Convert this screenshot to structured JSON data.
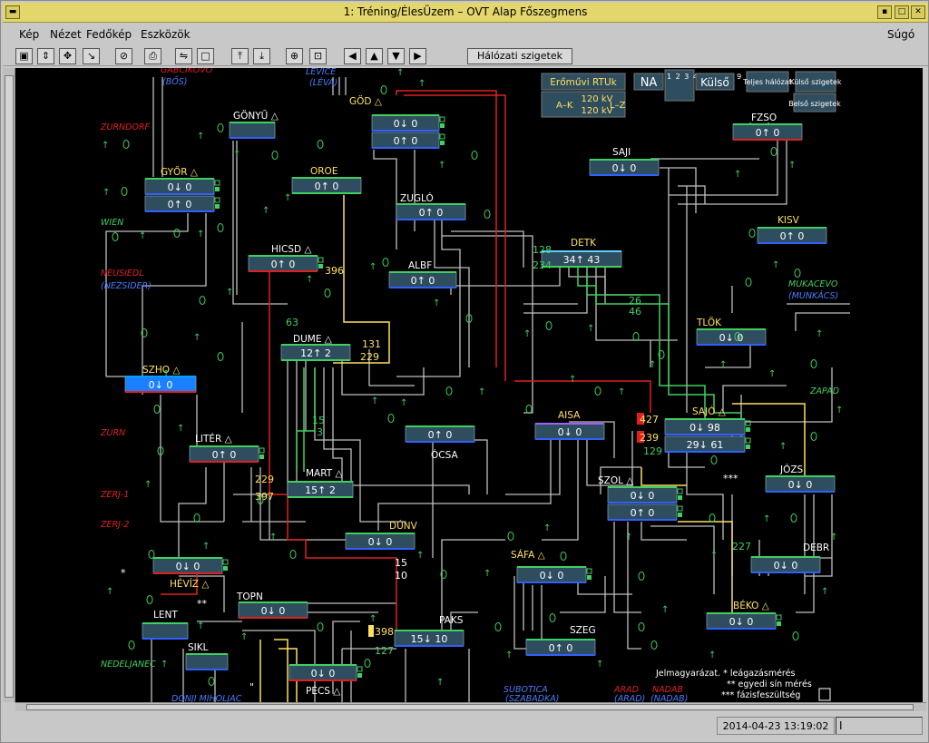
{
  "window": {
    "title": "1: Tréning/ÉlesÜzem – OVT     Alap    Főszegmens"
  },
  "menu": {
    "kep": "Kép",
    "nezet": "Nézet",
    "fedokep": "Fedőkép",
    "eszkozok": "Eszközök",
    "sugo": "Súgó"
  },
  "toolbar": {
    "network_islands": "Hálózati szigetek"
  },
  "panel": {
    "rtu": "Erőművi RTUk",
    "kv1": "120 kV",
    "kv2": "120 kV",
    "ak": "A–K",
    "lz": "L–Z",
    "na": "NA",
    "nums": "1 2 3 4 5 6 7 8 9",
    "kulso": "Külső",
    "teljes": "Teljes hálózat",
    "kulso_sz": "Külső szigetek",
    "belso_sz": "Belső szigetek"
  },
  "legend": {
    "title": "Jelmagyarázat. *  leágazásmérés",
    "l2": "** egyedi sín mérés",
    "l3": "*** fázisfeszültség"
  },
  "status": {
    "datetime": "2014-04-23 13:19:02",
    "cursor": "I"
  },
  "ext_labels": [
    {
      "id": "gabcikovo",
      "t": "GABCIKOVO",
      "c": "#e02020"
    },
    {
      "id": "bos",
      "t": "(BŐS)",
      "c": "#4a7cff"
    },
    {
      "id": "levice",
      "t": "LEVICE",
      "c": "#4a7cff"
    },
    {
      "id": "leva",
      "t": "(LÉVA)",
      "c": "#4a7cff"
    },
    {
      "id": "zurndorf",
      "t": "ZURNDORF",
      "c": "#e02020"
    },
    {
      "id": "wien",
      "t": "WIEN",
      "c": "#40d060"
    },
    {
      "id": "neusiedl",
      "t": "NEUSIEDL",
      "c": "#e02020"
    },
    {
      "id": "nezsider",
      "t": "(NEZSIDER)",
      "c": "#4a7cff"
    },
    {
      "id": "zurn",
      "t": "ZURN",
      "c": "#e02020"
    },
    {
      "id": "zerj1",
      "t": "ZERJ-1",
      "c": "#e02020"
    },
    {
      "id": "zerj2",
      "t": "ZERJ-2",
      "c": "#e02020"
    },
    {
      "id": "nedeljanec",
      "t": "NEDELJANEC",
      "c": "#40d060"
    },
    {
      "id": "donji",
      "t": "DONJI MIHOLJAC",
      "c": "#4a7cff"
    },
    {
      "id": "subotica",
      "t": "SUBOTICA",
      "c": "#4a7cff"
    },
    {
      "id": "szabadka",
      "t": "(SZABADKA)",
      "c": "#4a7cff"
    },
    {
      "id": "arad",
      "t": "ARAD",
      "c": "#e02020"
    },
    {
      "id": "aradp",
      "t": "(ARAD)",
      "c": "#4a7cff"
    },
    {
      "id": "nadab",
      "t": "NADAB",
      "c": "#e02020"
    },
    {
      "id": "nadabp",
      "t": "(NADAB)",
      "c": "#4a7cff"
    },
    {
      "id": "mukacevo",
      "t": "MUKACEVO",
      "c": "#40d060"
    },
    {
      "id": "munkacs",
      "t": "(MUNKÁCS)",
      "c": "#4a7cff"
    },
    {
      "id": "zapad",
      "t": "ZAPAD",
      "c": "#40d060"
    }
  ],
  "stations": [
    {
      "id": "gonyu",
      "name": "GÖNYŰ △",
      "nc": "#ffffff",
      "rows": []
    },
    {
      "id": "god",
      "name": "GÖD △",
      "nc": "#ffe060",
      "rows": [
        "0↓ 0",
        "0↑ 0"
      ]
    },
    {
      "id": "gyor",
      "name": "GYŐR △",
      "nc": "#ffe060",
      "rows": [
        "0↓ 0",
        "0↑ 0"
      ]
    },
    {
      "id": "oroe",
      "name": "OROE",
      "nc": "#ffe060",
      "rows": [
        "0↑ 0"
      ]
    },
    {
      "id": "zuglo",
      "name": "ZUGLÓ",
      "nc": "#ffffff",
      "rows": [
        "0↑ 0"
      ]
    },
    {
      "id": "hicsd",
      "name": "HICSD △",
      "nc": "#ffffff",
      "rows": [
        "0↑ 0"
      ]
    },
    {
      "id": "albf",
      "name": "ALBF",
      "nc": "#ffffff",
      "rows": [
        "0↑ 0"
      ]
    },
    {
      "id": "detk",
      "name": "DETK",
      "nc": "#ffe060",
      "rows": [
        "34↑ 43"
      ]
    },
    {
      "id": "saji",
      "name": "SAJI",
      "nc": "#ffffff",
      "rows": [
        "0↓ 0"
      ]
    },
    {
      "id": "fzso",
      "name": "FZSO",
      "nc": "#ffffff",
      "rows": [
        "0↑ 0"
      ]
    },
    {
      "id": "kisv",
      "name": "KISV",
      "nc": "#ffe060",
      "rows": [
        "0↑ 0"
      ]
    },
    {
      "id": "tlok",
      "name": "TLÖK",
      "nc": "#ffe060",
      "rows": [
        "0↓ 0"
      ]
    },
    {
      "id": "dume",
      "name": "DUME △",
      "nc": "#ffffff",
      "rows": [
        "12↑ 2"
      ]
    },
    {
      "id": "szho",
      "name": "SZHO △",
      "nc": "#ffe060",
      "rows": [
        "0↓ 0"
      ]
    },
    {
      "id": "ocsa",
      "name": "ÓCSA",
      "nc": "#ffffff",
      "rows": [
        "0↑ 0"
      ]
    },
    {
      "id": "aisa",
      "name": "AISA",
      "nc": "#ffe060",
      "rows": [
        "0↓ 0"
      ]
    },
    {
      "id": "sajo",
      "name": "SAJÓ △",
      "nc": "#ffe060",
      "rows": [
        "0↓ 98",
        "29↓ 61"
      ]
    },
    {
      "id": "liter",
      "name": "LITÉR △",
      "nc": "#ffffff",
      "rows": [
        "0↑ 0"
      ]
    },
    {
      "id": "mart",
      "name": "MART △",
      "nc": "#ffffff",
      "rows": [
        "15↑ 2"
      ]
    },
    {
      "id": "szol",
      "name": "SZOL △",
      "nc": "#ffffff",
      "rows": [
        "0↓ 0",
        "0↑ 0"
      ]
    },
    {
      "id": "jozs",
      "name": "JÓZS",
      "nc": "#ffffff",
      "rows": [
        "0↓ 0"
      ]
    },
    {
      "id": "dunv",
      "name": "DÚNV",
      "nc": "#ffe060",
      "rows": [
        "0↓ 0"
      ]
    },
    {
      "id": "heviz",
      "name": "HÉVÍZ △",
      "nc": "#ffe060",
      "rows": [
        "0↓ 0"
      ]
    },
    {
      "id": "safa",
      "name": "SÁFA △",
      "nc": "#ffe060",
      "rows": [
        "0↓ 0"
      ]
    },
    {
      "id": "debr",
      "name": "DEBR",
      "nc": "#ffffff",
      "rows": [
        "0↓ 0"
      ]
    },
    {
      "id": "topn",
      "name": "TOPN",
      "nc": "#ffffff",
      "rows": [
        "0↓ 0"
      ]
    },
    {
      "id": "lent",
      "name": "LENT",
      "nc": "#ffffff",
      "rows": []
    },
    {
      "id": "paks",
      "name": "PAKS",
      "nc": "#ffffff",
      "rows": [
        "15↓ 10"
      ]
    },
    {
      "id": "szeg",
      "name": "SZEG",
      "nc": "#ffffff",
      "rows": [
        "0↑ 0"
      ]
    },
    {
      "id": "beko",
      "name": "BÉKO △",
      "nc": "#ffe060",
      "rows": [
        "0↓ 0"
      ]
    },
    {
      "id": "sikl",
      "name": "SIKL",
      "nc": "#ffffff",
      "rows": []
    },
    {
      "id": "pecs",
      "name": "PÉCS △",
      "nc": "#ffffff",
      "rows": [
        "0↓ 0"
      ]
    }
  ],
  "values": [
    {
      "id": "v396",
      "t": "396",
      "c": "#ffe060"
    },
    {
      "id": "v63",
      "t": "63",
      "c": "#40d060"
    },
    {
      "id": "v131",
      "t": "131",
      "c": "#ffe060"
    },
    {
      "id": "v229a",
      "t": "229",
      "c": "#ffe060"
    },
    {
      "id": "v128",
      "t": "128",
      "c": "#40d060"
    },
    {
      "id": "v234",
      "t": "234",
      "c": "#40d060"
    },
    {
      "id": "v26",
      "t": "26",
      "c": "#40d060"
    },
    {
      "id": "v46",
      "t": "46",
      "c": "#40d060"
    },
    {
      "id": "v15",
      "t": "15",
      "c": "#40d060"
    },
    {
      "id": "v3",
      "t": "3",
      "c": "#40d060"
    },
    {
      "id": "v427",
      "t": "427",
      "c": "#ffe060"
    },
    {
      "id": "v239",
      "t": "239",
      "c": "#ffe060"
    },
    {
      "id": "v129",
      "t": "129",
      "c": "#40d060"
    },
    {
      "id": "v229b",
      "t": "229",
      "c": "#ffe060"
    },
    {
      "id": "v397",
      "t": "397",
      "c": "#ffe060"
    },
    {
      "id": "v227",
      "t": "227",
      "c": "#40d060"
    },
    {
      "id": "v15b",
      "t": "15",
      "c": "#ffffff"
    },
    {
      "id": "v10",
      "t": "10",
      "c": "#ffffff"
    },
    {
      "id": "v398",
      "t": "398",
      "c": "#ffe060"
    },
    {
      "id": "v127",
      "t": "127",
      "c": "#40d060"
    },
    {
      "id": "s1",
      "t": "*",
      "c": "#ffffff"
    },
    {
      "id": "s2",
      "t": "**",
      "c": "#ffffff"
    },
    {
      "id": "s3",
      "t": "***",
      "c": "#ffffff"
    },
    {
      "id": "s4",
      "t": "\"",
      "c": "#ffffff"
    }
  ],
  "colors": {
    "bg": "#000000",
    "box": "#2e4d5e",
    "line_gray": "#c0c0c0",
    "line_red": "#e02020",
    "line_yellow": "#ffe060",
    "line_green": "#40d060",
    "blue": "#3060ff"
  }
}
